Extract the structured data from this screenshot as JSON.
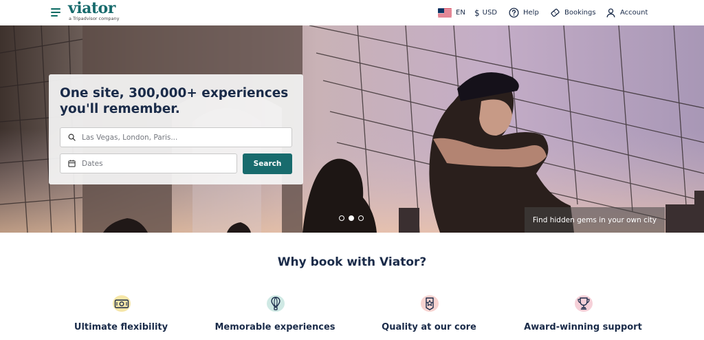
{
  "header": {
    "logo_text": "viator",
    "logo_subtitle": "a Tripadvisor company",
    "language": "EN",
    "currency": "USD",
    "help_label": "Help",
    "bookings_label": "Bookings",
    "account_label": "Account"
  },
  "hero": {
    "headline": "One site, 300,000+ experiences you'll remember.",
    "where_placeholder": "Las Vegas, London, Paris...",
    "dates_placeholder": "Dates",
    "search_button": "Search",
    "caption": "Find hidden gems in your own city",
    "carousel_active_index": 1,
    "carousel_count": 3
  },
  "why": {
    "title": "Why book with Viator?",
    "features": [
      {
        "icon": "money-icon",
        "label": "Ultimate flexibility",
        "blob_color": "#f7e7a8"
      },
      {
        "icon": "hot-air-balloon-icon",
        "label": "Memorable experiences",
        "blob_color": "#cfe9e4"
      },
      {
        "icon": "badge-star-icon",
        "label": "Quality at our core",
        "blob_color": "#f8d3d0"
      },
      {
        "icon": "trophy-icon",
        "label": "Award-winning support",
        "blob_color": "#f6d0d8"
      }
    ]
  },
  "colors": {
    "brand": "#186b6d",
    "text": "#1a2b49"
  }
}
